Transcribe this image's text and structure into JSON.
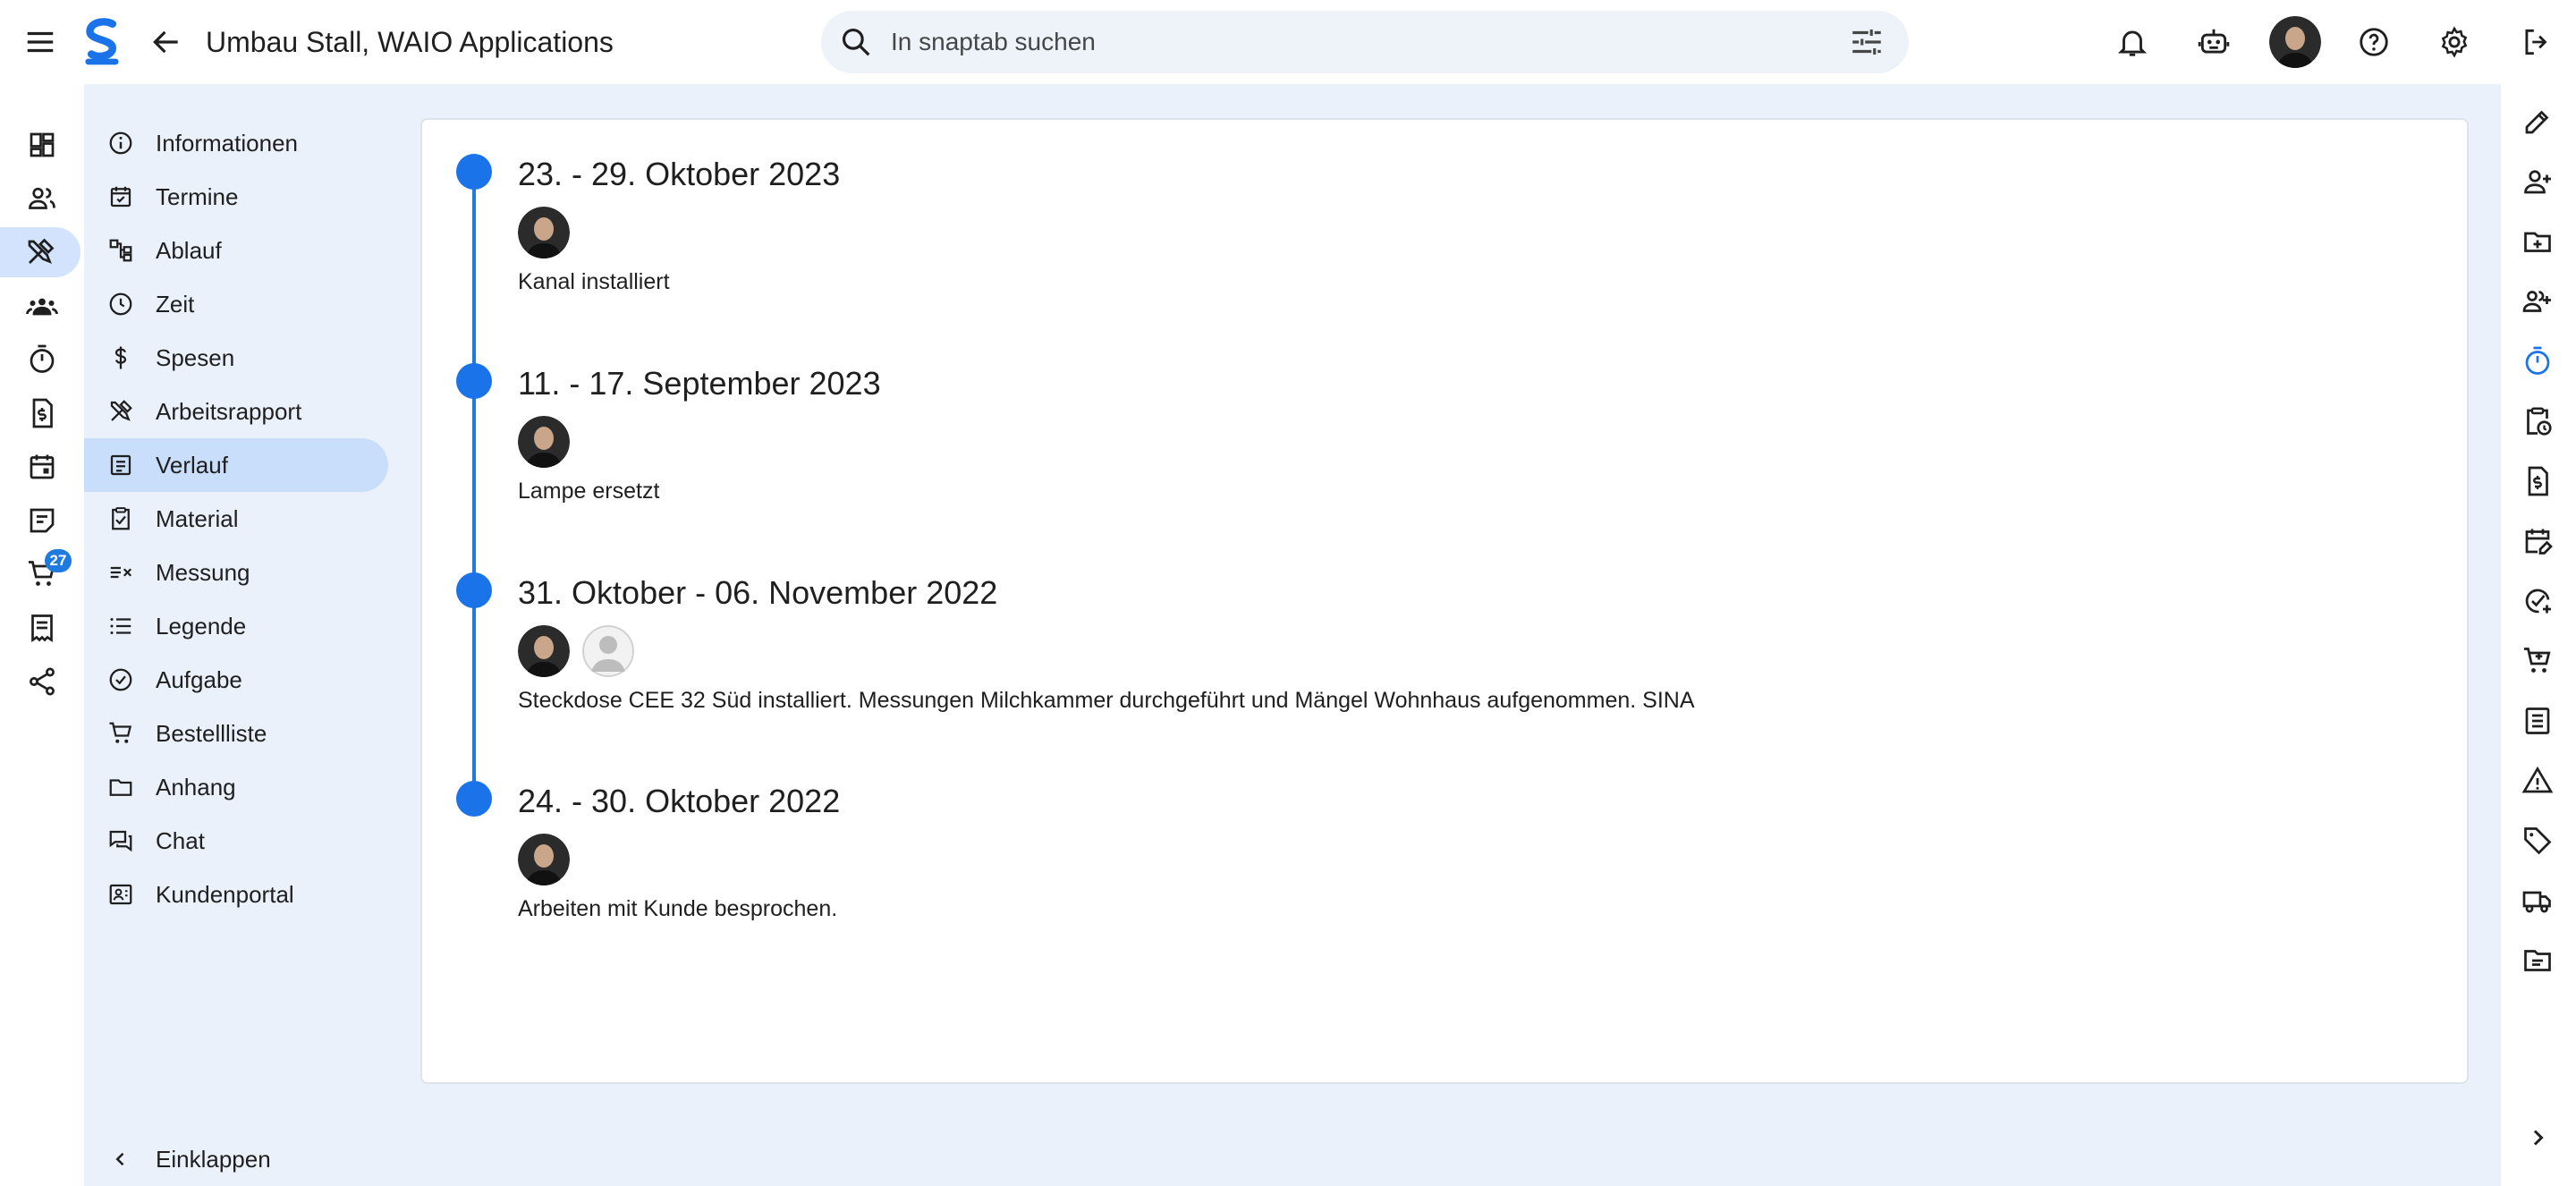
{
  "header": {
    "title": "Umbau Stall, WAIO Applications",
    "search_placeholder": "In snaptab suchen",
    "icons": [
      "menu-icon",
      "snaptab-logo",
      "arrow-back-icon",
      "search-icon",
      "tune-icon",
      "bell-icon",
      "robot-icon",
      "avatar",
      "help-icon",
      "gear-icon",
      "logout-icon"
    ]
  },
  "rail": {
    "items": [
      {
        "icon": "dashboard-icon"
      },
      {
        "icon": "people-icon"
      },
      {
        "icon": "tools-icon",
        "active": true
      },
      {
        "icon": "groups-icon"
      },
      {
        "icon": "timer-icon"
      },
      {
        "icon": "invoice-icon"
      },
      {
        "icon": "calendar-icon"
      },
      {
        "icon": "notes-icon"
      },
      {
        "icon": "cart-icon",
        "badge": "27"
      },
      {
        "icon": "receipt-icon"
      },
      {
        "icon": "share-icon"
      }
    ]
  },
  "nav": {
    "items": [
      {
        "label": "Informationen",
        "icon": "info-icon"
      },
      {
        "label": "Termine",
        "icon": "event-icon"
      },
      {
        "label": "Ablauf",
        "icon": "flow-icon"
      },
      {
        "label": "Zeit",
        "icon": "clock-icon"
      },
      {
        "label": "Spesen",
        "icon": "dollar-icon"
      },
      {
        "label": "Arbeitsrapport",
        "icon": "tools-icon"
      },
      {
        "label": "Verlauf",
        "icon": "history-icon",
        "active": true
      },
      {
        "label": "Material",
        "icon": "clipboard-check-icon"
      },
      {
        "label": "Messung",
        "icon": "measure-icon"
      },
      {
        "label": "Legende",
        "icon": "list-icon"
      },
      {
        "label": "Aufgabe",
        "icon": "check-circle-icon"
      },
      {
        "label": "Bestellliste",
        "icon": "cart-icon"
      },
      {
        "label": "Anhang",
        "icon": "folder-icon"
      },
      {
        "label": "Chat",
        "icon": "chat-icon"
      },
      {
        "label": "Kundenportal",
        "icon": "portal-icon"
      }
    ],
    "collapse_label": "Einklappen"
  },
  "timeline": {
    "entries": [
      {
        "title": "23. - 29. Oktober 2023",
        "avatars": [
          "photo"
        ],
        "text": "Kanal installiert"
      },
      {
        "title": "11. - 17. September 2023",
        "avatars": [
          "photo"
        ],
        "text": "Lampe ersetzt"
      },
      {
        "title": "31. Oktober - 06. November 2022",
        "avatars": [
          "photo",
          "placeholder"
        ],
        "text": "Steckdose CEE 32 Süd installiert. Messungen Milchkammer durchgeführt und Mängel Wohnhaus aufgenommen. SINA"
      },
      {
        "title": "24. - 30. Oktober 2022",
        "avatars": [
          "photo"
        ],
        "text": "Arbeiten mit Kunde besprochen."
      }
    ]
  },
  "right_rail": {
    "items": [
      "edit-icon",
      "person-add-icon",
      "folder-add-icon",
      "group-add-icon",
      "timer-icon",
      "clipboard-clock-icon",
      "invoice-icon",
      "calendar-edit-icon",
      "check-add-icon",
      "cart-add-icon",
      "list-icon",
      "warning-icon",
      "tag-icon",
      "truck-icon",
      "folder-notes-icon",
      "chevron-right-icon"
    ],
    "active": "timer-icon"
  },
  "colors": {
    "accent": "#1a73e8",
    "selected_bg": "#c9defa",
    "area_bg": "#eaf1fb",
    "text": "#1f1f1f"
  }
}
